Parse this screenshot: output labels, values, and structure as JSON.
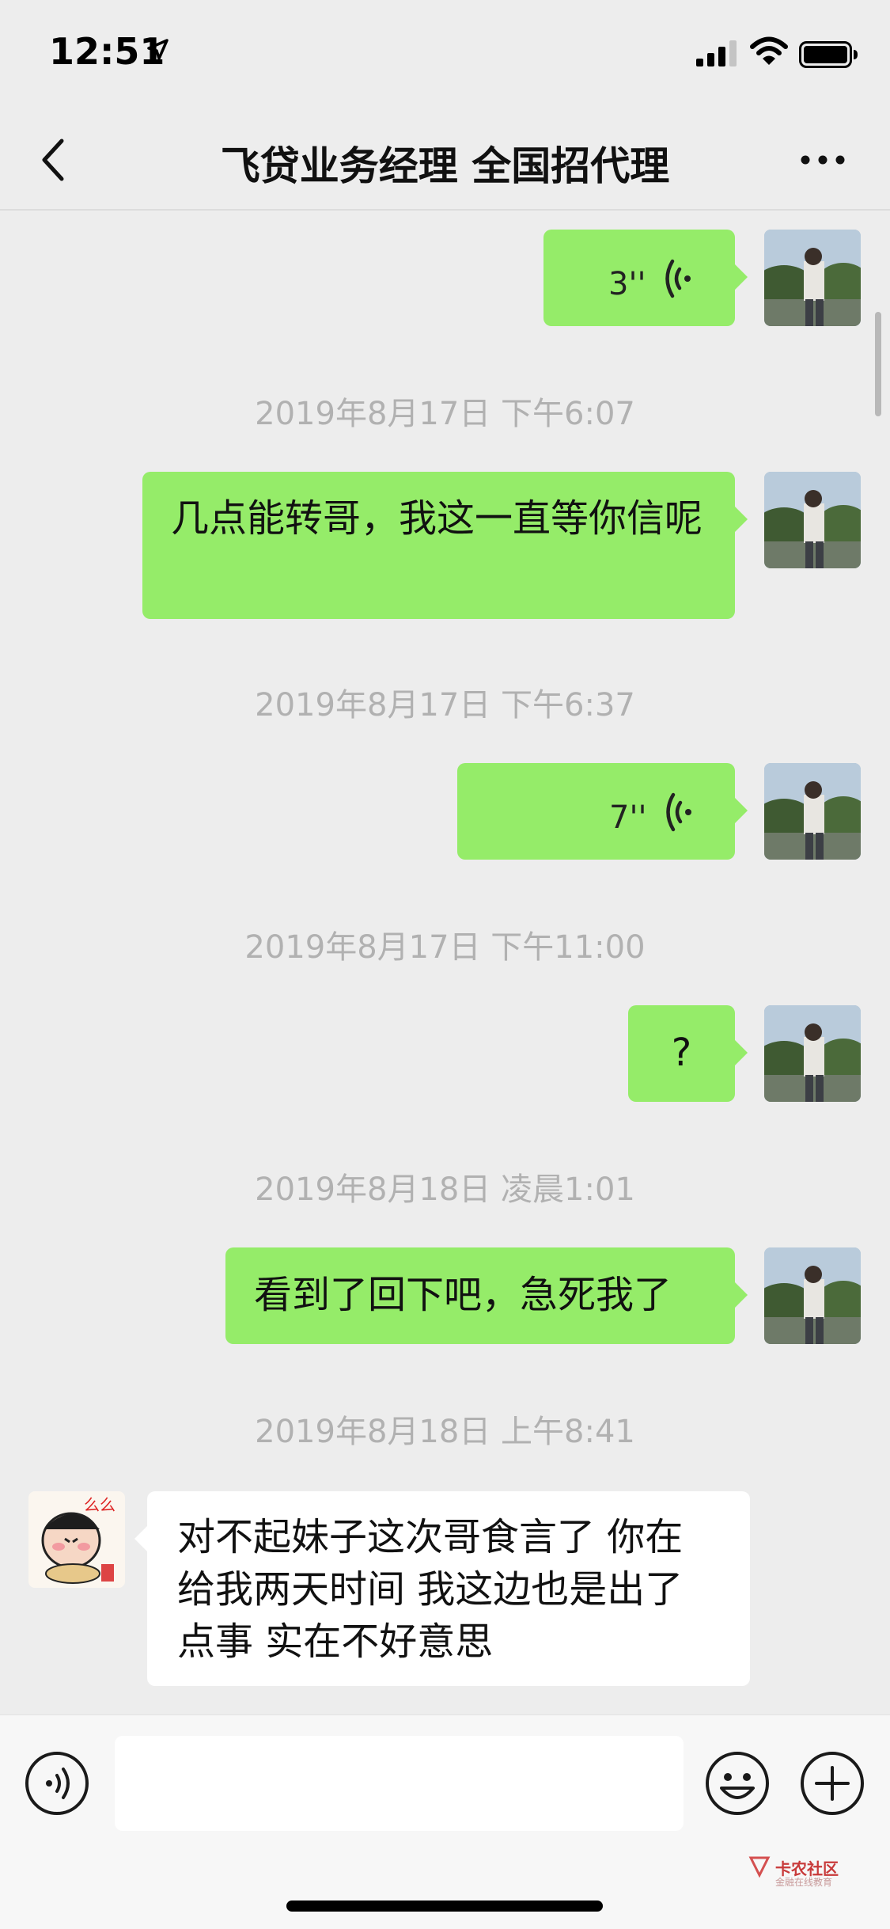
{
  "status_bar": {
    "time": "12:51"
  },
  "header": {
    "title": "飞贷业务经理 全国招代理"
  },
  "messages": {
    "v1_duration": "3''",
    "ts1": "2019年8月17日 下午6:07",
    "m1": "几点能转哥，我这一直等你信呢",
    "ts2": "2019年8月17日 下午6:37",
    "v2_duration": "7''",
    "ts3": "2019年8月17日 下午11:00",
    "m2": "?",
    "ts4": "2019年8月18日 凌晨1:01",
    "m3": "看到了回下吧，急死我了",
    "ts5": "2019年8月18日 上午8:41",
    "m4": "对不起妹子这次哥食言了 你在给我两天时间 我这边也是出了点事 实在不好意思"
  },
  "input_bar": {
    "placeholder": ""
  },
  "watermark": {
    "text": "卡农社区",
    "sub": "金融在线教育"
  },
  "colors": {
    "sent_bubble": "#95ec69",
    "received_bubble": "#ffffff",
    "background": "#ededed",
    "timestamp": "#b1b1b1"
  },
  "icons": [
    "location-arrow-icon",
    "signal-icon",
    "wifi-icon",
    "battery-icon",
    "back-chevron-icon",
    "more-icon",
    "voice-wave-icon",
    "voice-input-icon",
    "emoji-icon",
    "plus-icon"
  ]
}
